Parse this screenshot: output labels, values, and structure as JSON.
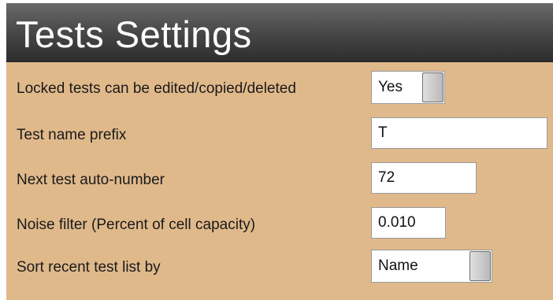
{
  "window": {
    "title": "Tests Settings"
  },
  "settings": {
    "locked_tests": {
      "label": "Locked tests can be edited/copied/deleted",
      "value": "Yes"
    },
    "name_prefix": {
      "label": "Test name prefix",
      "value": "T"
    },
    "auto_number": {
      "label": "Next test auto-number",
      "value": "72"
    },
    "noise_filter": {
      "label": "Noise filter (Percent of cell capacity)",
      "value": "0.010"
    },
    "sort_by": {
      "label": "Sort recent test list by",
      "value": "Name"
    }
  },
  "colors": {
    "panel_background": "#e0b98b",
    "header_dark": "#2d2d2d"
  }
}
